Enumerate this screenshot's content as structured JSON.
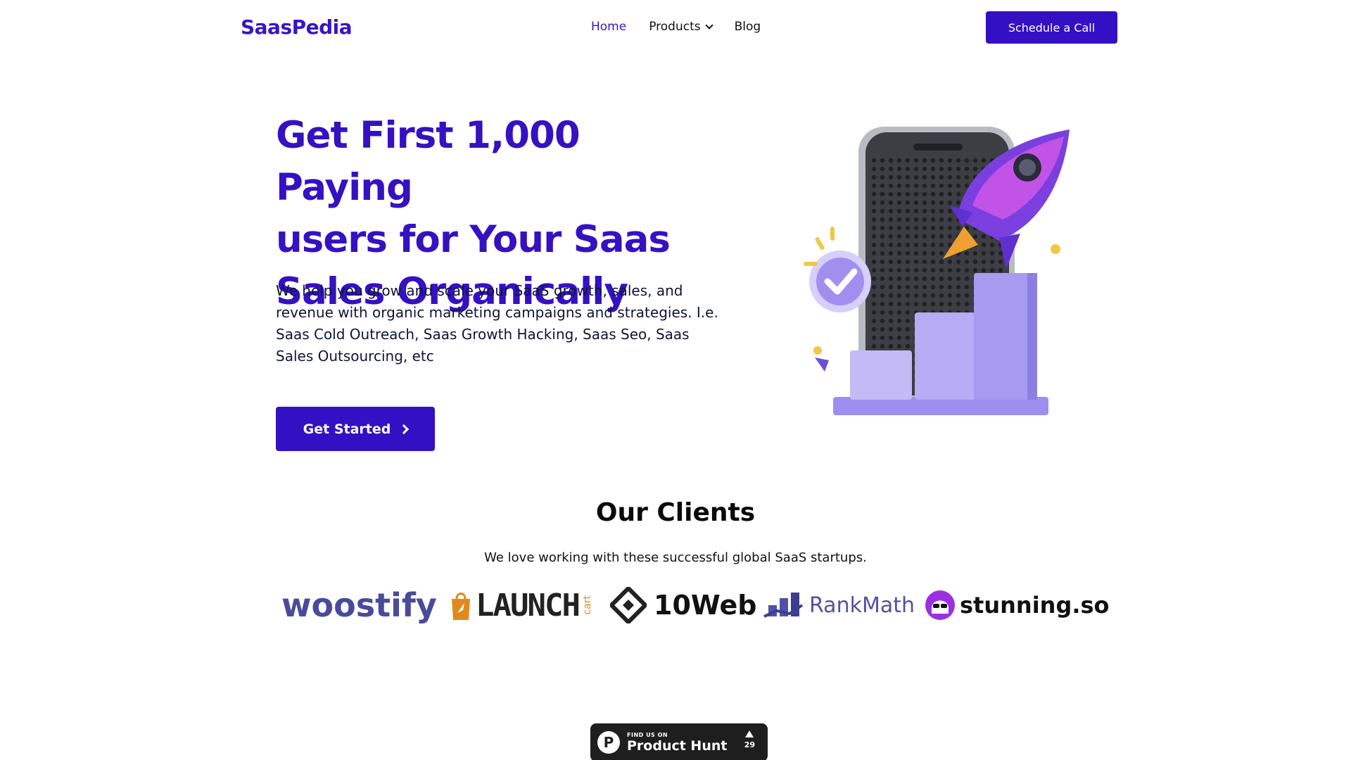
{
  "header": {
    "brand": "SaasPedia",
    "nav": {
      "home": "Home",
      "products": "Products",
      "blog": "Blog"
    },
    "cta": "Schedule a Call"
  },
  "hero": {
    "title_line1": "Get First 1,000 Paying",
    "title_line2": "users for Your Saas",
    "title_line3": "Sales Organically",
    "text_line1": "We help you grow and scale your SaaS growth, sales, and",
    "text_line2": "revenue with organic marketing campaigns and strategies. I.e.",
    "text_line3": "Saas Cold Outreach, Saas Growth Hacking, Saas Seo, Saas",
    "text_line4": "Sales Outsourcing, etc",
    "button": "Get Started",
    "illustration_icons": [
      "phone-icon",
      "rocket-icon",
      "check-badge-icon",
      "bar-chart-icon"
    ]
  },
  "clients": {
    "title": "Our Clients",
    "subtitle": "We love working with these successful global SaaS startups.",
    "logos": {
      "woostify": "woostify",
      "launch": "LAUNCH",
      "launch_cart": "cart",
      "tenweb": "10Web",
      "rankmath": "RankMath",
      "stunning": "stunning.so"
    }
  },
  "product_hunt": {
    "small": "FIND US ON",
    "big": "Product Hunt",
    "votes": "29",
    "logo_letter": "P"
  },
  "colors": {
    "brand": "#3511c2",
    "button": "#3410c4",
    "illustration_purple": "#a99af0",
    "badge_bg": "#1e1e1e"
  }
}
